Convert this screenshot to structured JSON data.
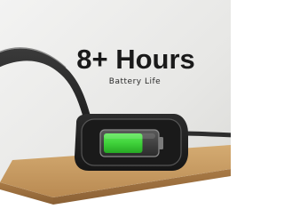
{
  "headline": "8+ Hours",
  "subheadline": "Battery Life",
  "battery_level": 0.75,
  "colors": {
    "background": "#e9e9e7",
    "headphone": "#2b2b2b",
    "battery_fill": "#3fd23a",
    "table_top": "#c69b62"
  }
}
